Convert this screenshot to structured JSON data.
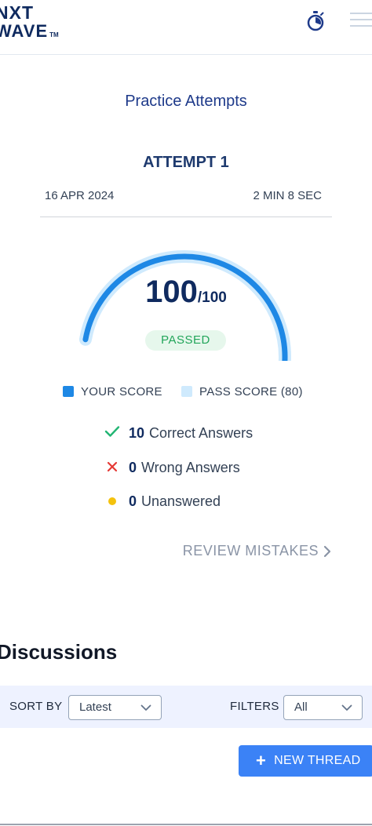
{
  "header": {
    "logo_line1": "NXT",
    "logo_line2": "WAVE",
    "logo_tm": "TM",
    "timer_icon": "stopwatch-icon",
    "menu_icon": "hamburger-menu-icon"
  },
  "practice": {
    "title": "Practice Attempts",
    "attempt_label": "ATTEMPT 1",
    "date": "16 APR 2024",
    "duration": "2 MIN 8 SEC"
  },
  "score": {
    "value": "100",
    "total": "/100",
    "your_score_fraction": 1.0,
    "pass_score_fraction": 0.8,
    "status": "PASSED",
    "colors": {
      "your_score": "#1e88e5",
      "pass_score": "#cfeafd",
      "passed_bg": "#e6f7ec",
      "passed_text": "#22a55a"
    }
  },
  "legend": {
    "your_score": "YOUR SCORE",
    "pass_score": "PASS SCORE (80)"
  },
  "stats": {
    "correct": {
      "count": "10",
      "label": "Correct Answers",
      "icon": "check-icon",
      "color": "#22b573"
    },
    "wrong": {
      "count": "0",
      "label": "Wrong Answers",
      "icon": "cross-icon",
      "color": "#e53935"
    },
    "unanswered": {
      "count": "0",
      "label": "Unanswered",
      "icon": "dot-icon",
      "color": "#f4c20d"
    }
  },
  "review": {
    "label": "REVIEW MISTAKES",
    "icon": "chevron-right-icon"
  },
  "discussions": {
    "title": "Discussions",
    "sort_label": "SORT BY",
    "sort_value": "Latest",
    "filters_label": "FILTERS",
    "filters_value": "All",
    "new_thread_label": "NEW THREAD",
    "new_thread_icon": "plus-icon"
  }
}
